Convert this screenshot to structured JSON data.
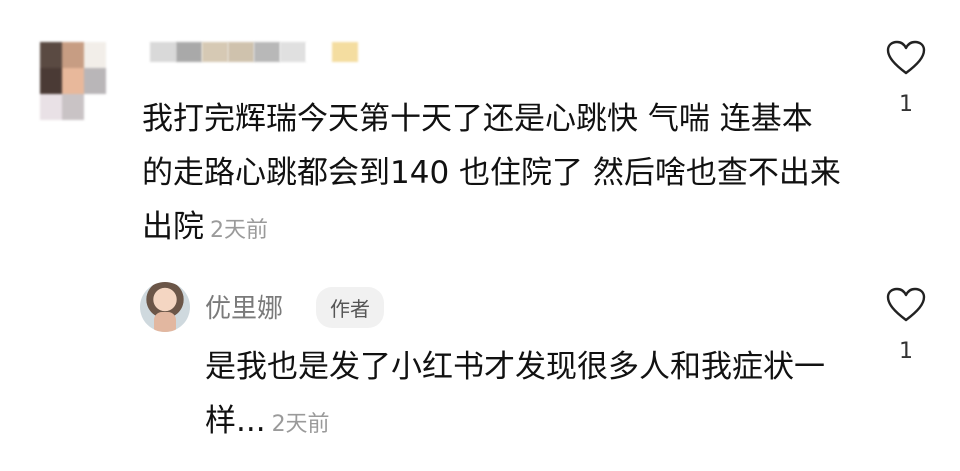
{
  "comment": {
    "text": "我打完辉瑞今天第十天了还是心跳快 气喘 连基本的走路心跳都会到140 也住院了 然后啥也查不出来出院",
    "time": "2天前",
    "like_count": "1"
  },
  "reply": {
    "username": "优里娜",
    "author_tag": "作者",
    "text": "是我也是发了小红书才发现很多人和我症状一样...",
    "time": "2天前",
    "like_count": "1"
  },
  "icons": {
    "like": "heart-outline-icon"
  }
}
